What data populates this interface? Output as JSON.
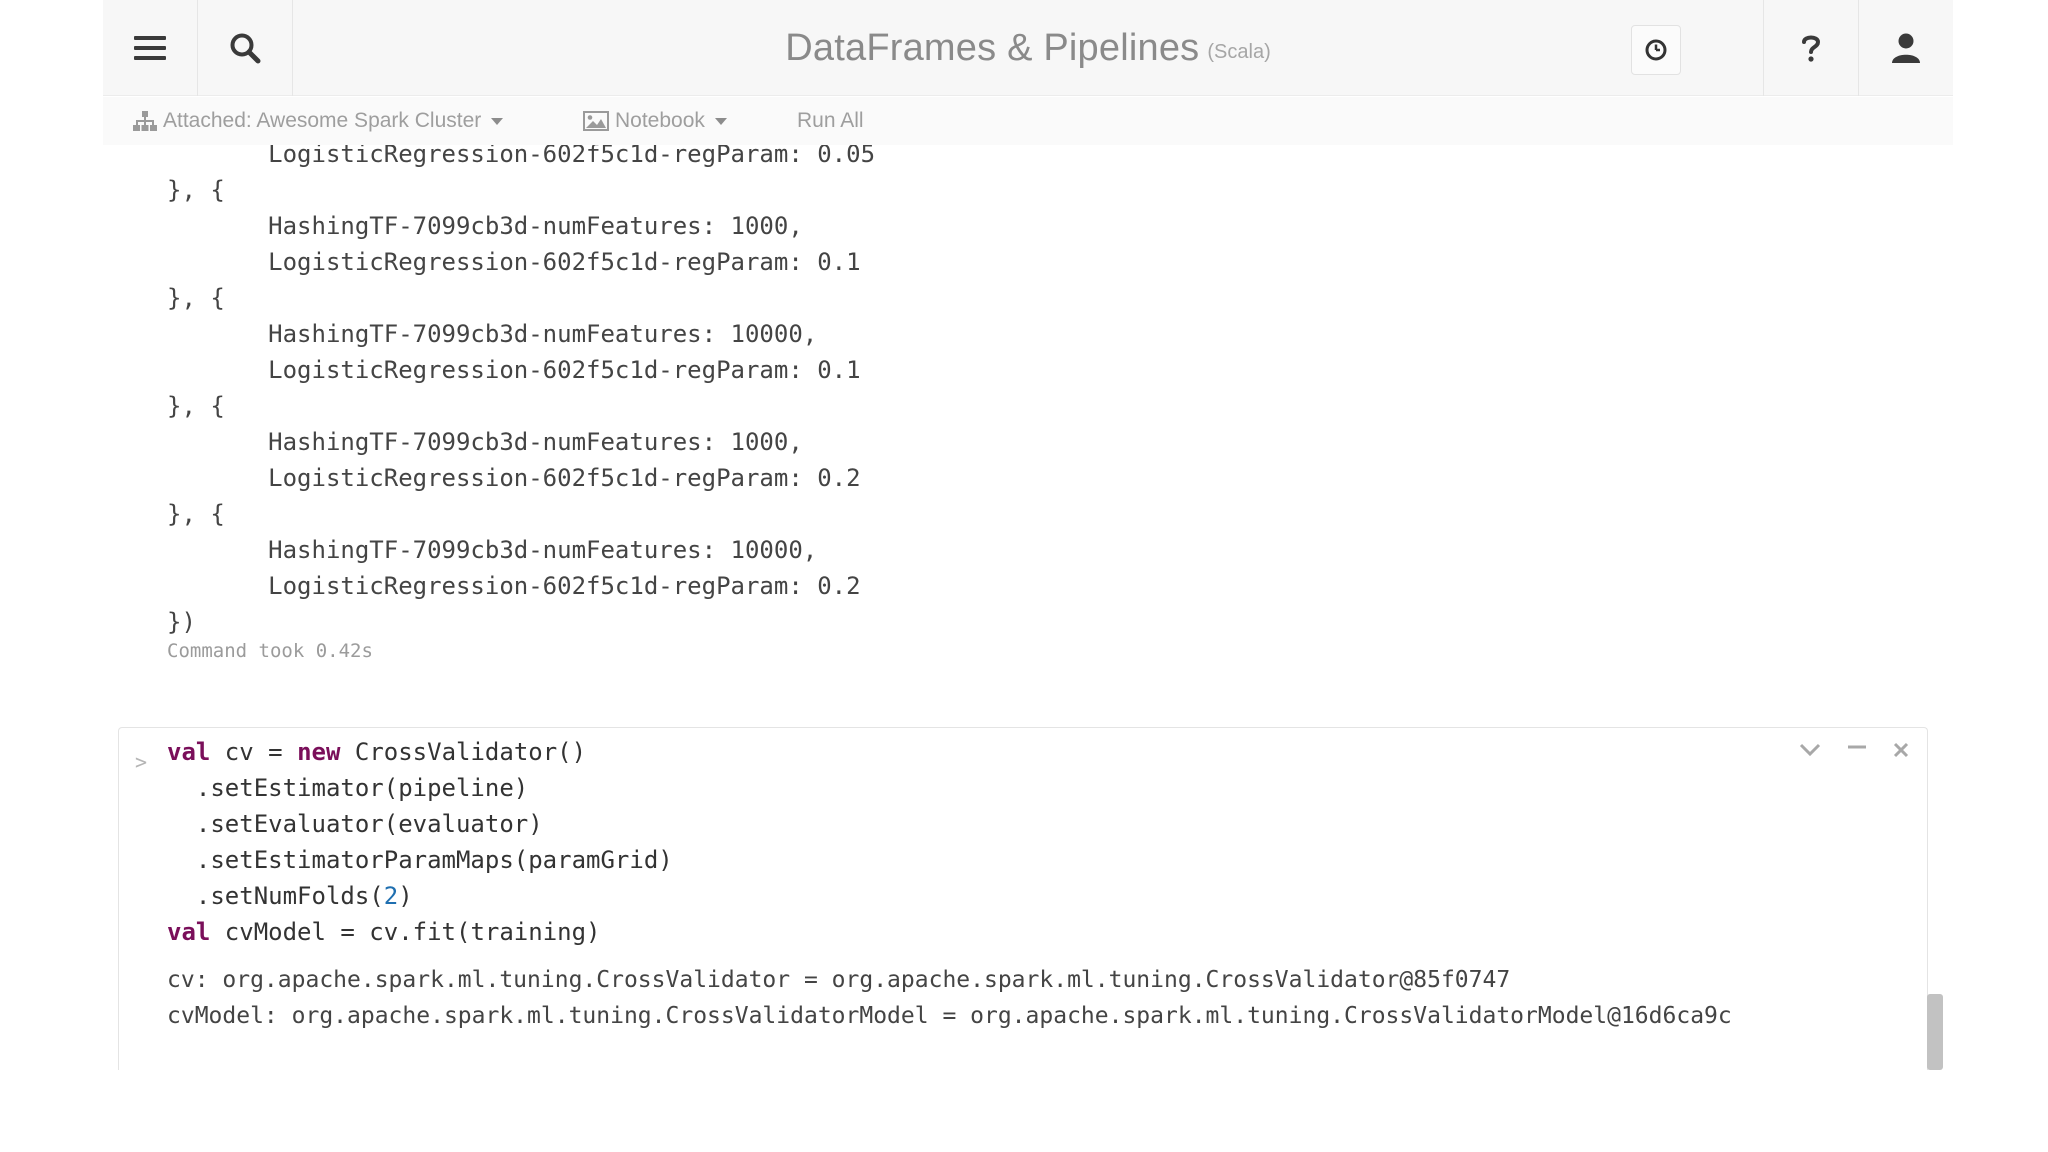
{
  "header": {
    "title": "DataFrames & Pipelines",
    "language": "(Scala)",
    "icons": [
      "menu-icon",
      "search-icon",
      "clock-icon",
      "help-icon",
      "user-icon"
    ]
  },
  "toolbar": {
    "cluster_label": "Attached: Awesome Spark Cluster",
    "notebook_label": "Notebook",
    "run_all_label": "Run All"
  },
  "output": {
    "lines": [
      "       LogisticRegression-602f5c1d-regParam: 0.05",
      "}, {",
      "       HashingTF-7099cb3d-numFeatures: 1000,",
      "       LogisticRegression-602f5c1d-regParam: 0.1",
      "}, {",
      "       HashingTF-7099cb3d-numFeatures: 10000,",
      "       LogisticRegression-602f5c1d-regParam: 0.1",
      "}, {",
      "       HashingTF-7099cb3d-numFeatures: 1000,",
      "       LogisticRegression-602f5c1d-regParam: 0.2",
      "}, {",
      "       HashingTF-7099cb3d-numFeatures: 10000,",
      "       LogisticRegression-602f5c1d-regParam: 0.2",
      "})"
    ],
    "command_took": "Command took 0.42s"
  },
  "cell": {
    "prompt": ">",
    "code": [
      {
        "kw": "val",
        "rest": " cv = ",
        "kw2": "new",
        "rest2": " CrossValidator()"
      },
      {
        "text": "  .setEstimator(pipeline)"
      },
      {
        "text": "  .setEvaluator(evaluator)"
      },
      {
        "text": "  .setEstimatorParamMaps(paramGrid)"
      },
      {
        "pre": "  .setNumFolds(",
        "num": "2",
        "post": ")"
      },
      {
        "kw": "val",
        "rest": " cvModel = cv.fit(training)"
      }
    ],
    "results": [
      "cv: org.apache.spark.ml.tuning.CrossValidator = org.apache.spark.ml.tuning.CrossValidator@85f0747",
      "cvModel: org.apache.spark.ml.tuning.CrossValidatorModel = org.apache.spark.ml.tuning.CrossValidatorModel@16d6ca9c"
    ]
  }
}
